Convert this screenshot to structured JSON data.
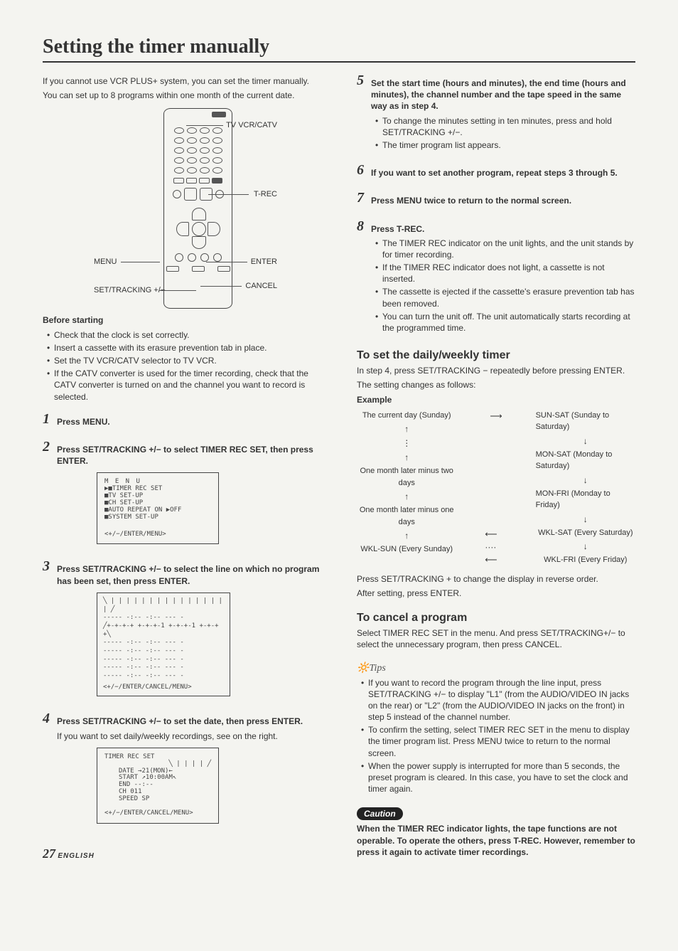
{
  "title": "Setting the timer manually",
  "intro1": "If you cannot use VCR PLUS+ system, you can set the timer manually.",
  "intro2": "You can set up to 8 programs within one month of the current date.",
  "remote_labels": {
    "tv": "TV VCR/CATV",
    "trec": "T-REC",
    "enter": "ENTER",
    "cancel": "CANCEL",
    "menu": "MENU",
    "set": "SET/TRACKING +/−"
  },
  "before_heading": "Before starting",
  "before_items": [
    "Check that the clock is set correctly.",
    "Insert a cassette with its erasure prevention tab in place.",
    "Set the TV VCR/CATV selector to TV VCR.",
    "If the CATV converter is used for the timer recording, check that the CATV converter is turned on and the channel you want to record is selected."
  ],
  "steps": {
    "s1": "Press MENU.",
    "s2": "Press SET/TRACKING +/− to select TIMER REC SET, then press ENTER.",
    "s3": "Press SET/TRACKING +/− to select the line on which no program has been set, then press ENTER.",
    "s4": "Press SET/TRACKING +/− to set the date, then press ENTER.",
    "s4note": "If you want to set daily/weekly recordings, see on the right.",
    "s5": "Set the start time (hours and minutes), the end time (hours and minutes), the channel number and the tape speed in the same way as in step 4.",
    "s5b1": "To change the minutes setting in ten minutes, press and hold SET/TRACKING +/−.",
    "s5b2": "The timer program list appears.",
    "s6": "If you want to set another program, repeat steps 3 through 5.",
    "s7": "Press MENU twice to return to the normal screen.",
    "s8": "Press T-REC.",
    "s8items": [
      "The TIMER REC indicator on the unit lights, and the unit stands by for timer recording.",
      "If the TIMER REC indicator does not light, a cassette is not inserted.",
      "The cassette is ejected if the cassette's erasure prevention tab has been removed.",
      "You can turn the unit off. The unit automatically starts recording at the programmed time."
    ]
  },
  "menu_screen": {
    "l1": "M E N U",
    "l2": "▶■TIMER REC SET",
    "l3": "■TV SET-UP",
    "l4": "■CH SET-UP",
    "l5": "■AUTO REPEAT  ON ▶OFF",
    "l6": "■SYSTEM SET-UP",
    "foot": "<+/−/ENTER/MENU>"
  },
  "table_screen": {
    "head": "╲  | | | | | | | | | | | | | | | | ╱",
    "row": "----- -:-- -:-- --- -",
    "rowh": "╱+-+-+-+ +-+-+-1 +-+-+-1 +-+-+ +╲",
    "foot": "<+/−/ENTER/CANCEL/MENU>"
  },
  "rec_screen": {
    "t": "TIMER REC SET",
    "l1": "DATE   →21(MON)←",
    "l2": "START  ↗10:00AM↖",
    "l3": "END      --:--",
    "l4": "CH       011",
    "l5": "SPEED    SP",
    "foot": "<+/−/ENTER/CANCEL/MENU>"
  },
  "daily": {
    "heading": "To set the daily/weekly timer",
    "p1": "In step 4, press SET/TRACKING − repeatedly before pressing ENTER.",
    "p2": "The setting changes as follows:",
    "example": "Example",
    "left": [
      "The current day (Sunday)",
      "↑",
      "⋮",
      "↑",
      "One month later minus two days",
      "↑",
      "One month later minus one days",
      "↑",
      "WKL-SUN (Every Sunday)"
    ],
    "right": [
      "SUN-SAT (Sunday to Saturday)",
      "↓",
      "MON-SAT (Monday to Saturday)",
      "↓",
      "MON-FRI (Monday to Friday)",
      "↓",
      "WKL-SAT (Every Saturday)",
      "↓",
      "WKL-FRI (Every Friday)"
    ],
    "toparrow": "⟶",
    "botarrow": "⟵ ···· ⟵",
    "p3": "Press SET/TRACKING + to change the display in reverse order.",
    "p4": "After setting, press ENTER."
  },
  "cancel": {
    "heading": "To cancel a program",
    "p": "Select TIMER REC SET in the menu.  And press SET/TRACKING+/− to select the unnecessary program, then press CANCEL."
  },
  "tips": {
    "label": "Tips",
    "items": [
      "If you want to record the program through the line input, press SET/TRACKING +/− to display \"L1\" (from the AUDIO/VIDEO IN jacks on the rear) or \"L2\" (from the AUDIO/VIDEO IN jacks on the front) in step 5 instead of the channel number.",
      "To confirm the setting, select TIMER REC SET in the menu to display the timer program list. Press MENU twice to return to the normal screen.",
      "When the power supply is interrupted for more than 5 seconds, the preset program is cleared. In this case, you have to set the clock and timer again."
    ]
  },
  "caution": {
    "label": "Caution",
    "text": "When the TIMER REC indicator lights, the tape functions are not operable. To operate the others, press T-REC. However, remember to press it again to activate timer recordings."
  },
  "footer": {
    "page": "27",
    "lang": "ENGLISH"
  }
}
